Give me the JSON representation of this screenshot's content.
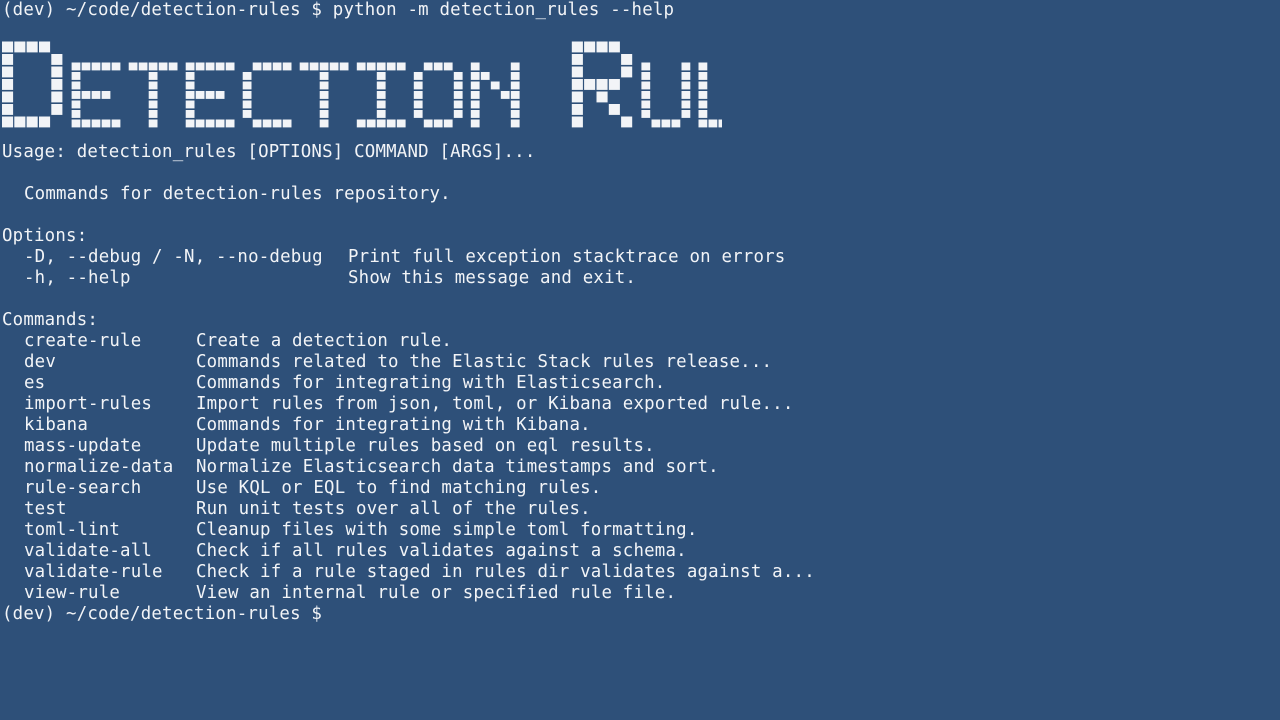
{
  "command_line": {
    "prompt": "(dev) ~/code/detection-rules $",
    "command": "python -m detection_rules --help"
  },
  "banner": {
    "text": "Detection Rules"
  },
  "usage": "Usage: detection_rules [OPTIONS] COMMAND [ARGS]...",
  "description": "Commands for detection-rules repository.",
  "options": {
    "heading": "Options:",
    "items": [
      {
        "flag": "-D, --debug / -N, --no-debug",
        "desc": "Print full exception stacktrace on errors"
      },
      {
        "flag": "-h, --help",
        "desc": "Show this message and exit."
      }
    ]
  },
  "commands": {
    "heading": "Commands:",
    "items": [
      {
        "name": "create-rule",
        "desc": "Create a detection rule."
      },
      {
        "name": "dev",
        "desc": "Commands related to the Elastic Stack rules release..."
      },
      {
        "name": "es",
        "desc": "Commands for integrating with Elasticsearch."
      },
      {
        "name": "import-rules",
        "desc": "Import rules from json, toml, or Kibana exported rule..."
      },
      {
        "name": "kibana",
        "desc": "Commands for integrating with Kibana."
      },
      {
        "name": "mass-update",
        "desc": "Update multiple rules based on eql results."
      },
      {
        "name": "normalize-data",
        "desc": "Normalize Elasticsearch data timestamps and sort."
      },
      {
        "name": "rule-search",
        "desc": "Use KQL or EQL to find matching rules."
      },
      {
        "name": "test",
        "desc": "Run unit tests over all of the rules."
      },
      {
        "name": "toml-lint",
        "desc": "Cleanup files with some simple toml formatting."
      },
      {
        "name": "validate-all",
        "desc": "Check if all rules validates against a schema."
      },
      {
        "name": "validate-rule",
        "desc": "Check if a rule staged in rules dir validates against a..."
      },
      {
        "name": "view-rule",
        "desc": "View an internal rule or specified rule file."
      }
    ]
  },
  "final_prompt": "(dev) ~/code/detection-rules $",
  "colors": {
    "background": "#2e5079",
    "foreground": "#f2f4f7"
  }
}
